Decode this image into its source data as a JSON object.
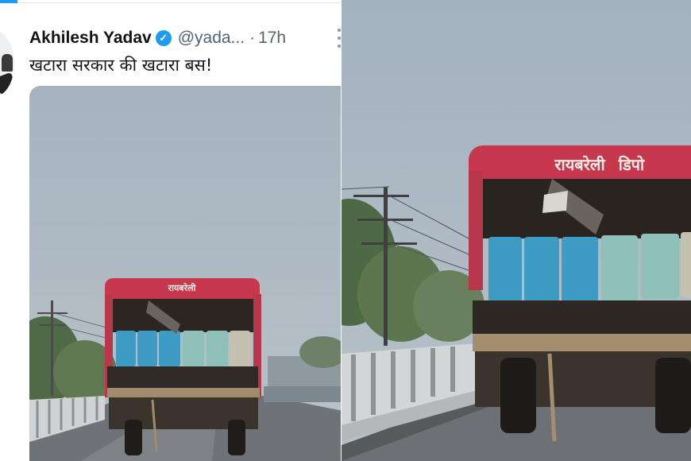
{
  "tweet": {
    "author_name": "Akhilesh Yadav",
    "verified_mark": "✓",
    "handle": "@yada...",
    "separator": "·",
    "time_ago": "17h",
    "text": "खटारा सरकार की खटारा बस!",
    "more_icon": "more-icon",
    "avatar_icon": "avatar"
  },
  "photo": {
    "bus_sign": "रायबरेली",
    "bus_sign_small": "डिपो"
  },
  "colors": {
    "accent": "#1d9bf0",
    "sky": "#a9b6c2",
    "bus_red": "#c8384c",
    "seat_blue": "#3d9bc4",
    "seat_pale": "#8fc0b8"
  }
}
